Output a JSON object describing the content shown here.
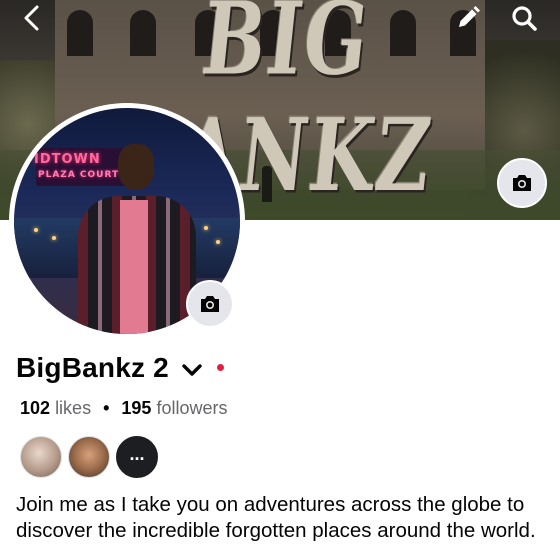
{
  "cover": {
    "logo_text": "BIG BANKZ"
  },
  "header": {
    "back_icon": "chevron-left-icon",
    "edit_icon": "pencil-icon",
    "search_icon": "search-icon"
  },
  "avatar": {
    "sign_line1": "IDTOWN",
    "sign_line2": "PLAZA COURT"
  },
  "profile": {
    "name": "BigBankz 2",
    "likes_count": "102",
    "likes_label": "likes",
    "separator": "•",
    "followers_count": "195",
    "followers_label": "followers",
    "friends_more_label": "...",
    "bio": "Join me as I take you on adventures across the globe to discover the incredible forgotten places around the world."
  },
  "colors": {
    "text_primary": "#050505",
    "text_secondary": "#65676b",
    "badge_bg": "#e4e6eb",
    "status_dot": "#e41e3f"
  }
}
